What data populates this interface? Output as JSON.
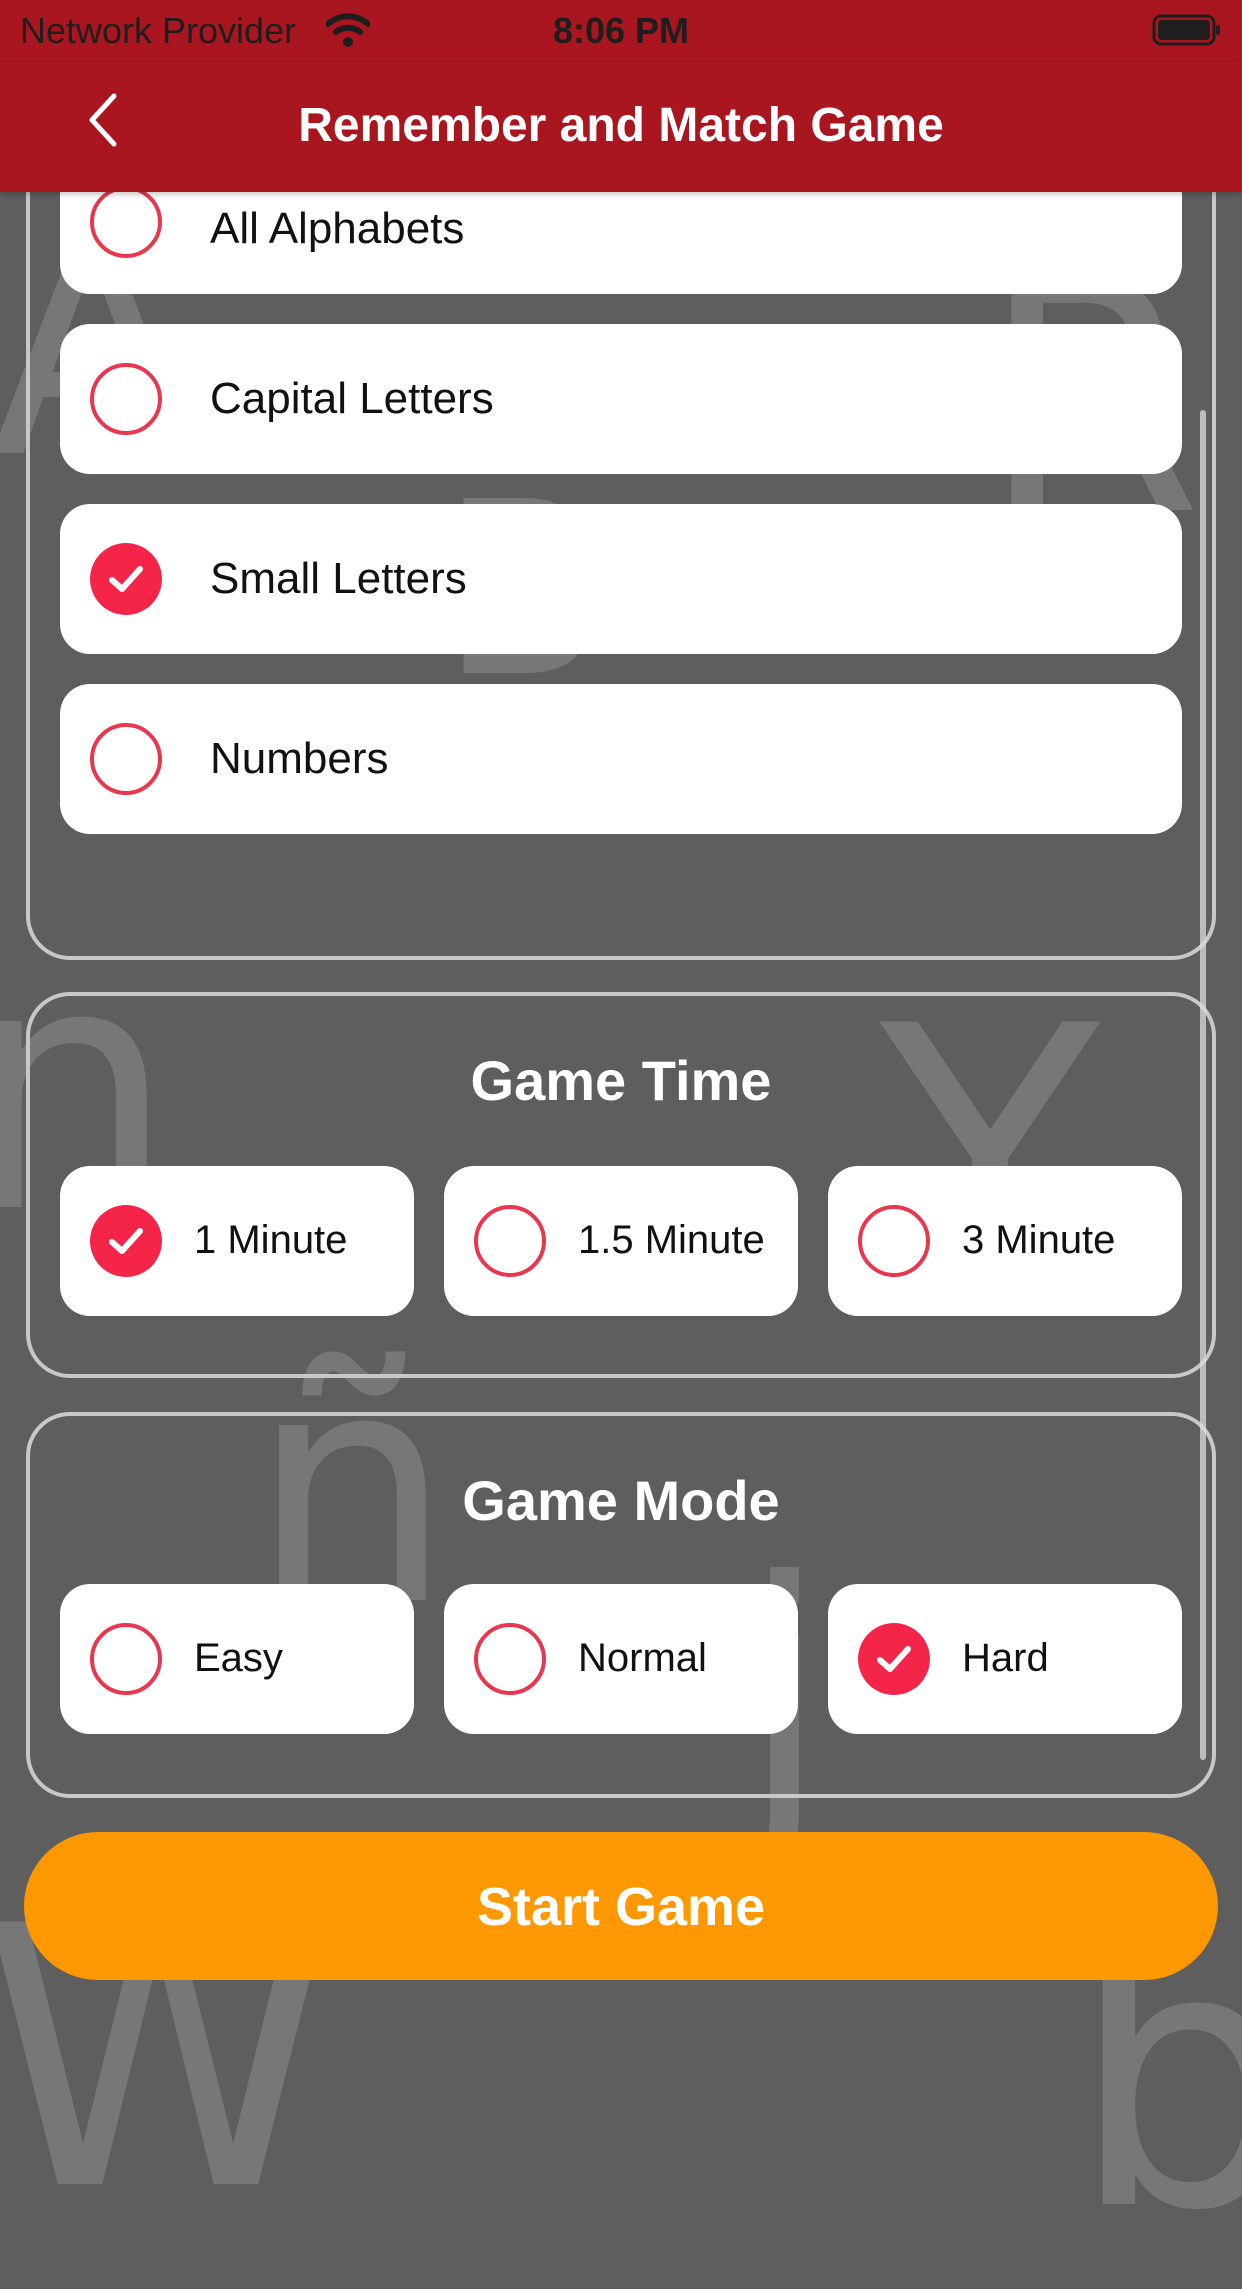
{
  "status_bar": {
    "carrier": "Network Provider",
    "time": "8:06 PM"
  },
  "nav": {
    "title": "Remember and Match Game",
    "back_icon": "chevron-left-icon"
  },
  "letter_type": {
    "options": [
      {
        "label": "All Alphabets",
        "checked": false
      },
      {
        "label": "Capital Letters",
        "checked": false
      },
      {
        "label": "Small Letters",
        "checked": true
      },
      {
        "label": "Numbers",
        "checked": false
      }
    ]
  },
  "game_time": {
    "title": "Game Time",
    "options": [
      {
        "label": "1 Minute",
        "checked": true
      },
      {
        "label": "1.5 Minute",
        "checked": false
      },
      {
        "label": "3 Minute",
        "checked": false
      }
    ]
  },
  "game_mode": {
    "title": "Game Mode",
    "options": [
      {
        "label": "Easy",
        "checked": false
      },
      {
        "label": "Normal",
        "checked": false
      },
      {
        "label": "Hard",
        "checked": true
      }
    ]
  },
  "start_button": {
    "label": "Start Game"
  },
  "colors": {
    "header": "#a9161f",
    "background": "#5e5e5e",
    "accent": "#f5254a",
    "start_button": "#fe9800"
  }
}
